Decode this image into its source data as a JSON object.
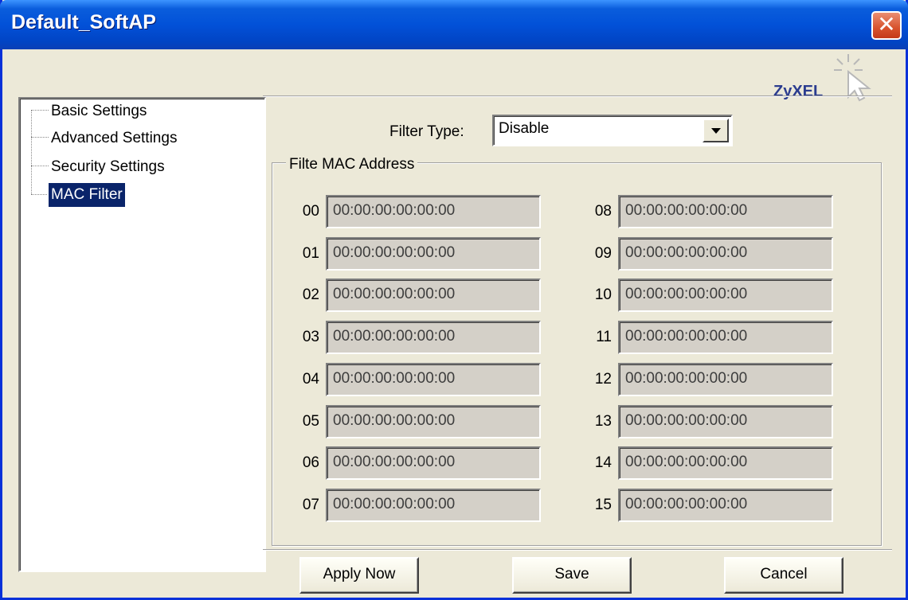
{
  "window": {
    "title": "Default_SoftAP",
    "close_glyph": "✕"
  },
  "logo": {
    "text": "ZyXEL",
    "icon": "cursor-click-icon"
  },
  "tree": {
    "items": [
      {
        "label": "Basic Settings",
        "selected": false
      },
      {
        "label": "Advanced Settings",
        "selected": false
      },
      {
        "label": "Security Settings",
        "selected": false
      },
      {
        "label": "MAC Filter",
        "selected": true
      }
    ]
  },
  "filter": {
    "label": "Filter Type:",
    "value": "Disable"
  },
  "mac_group": {
    "label": "Filte MAC Address",
    "entries": [
      {
        "index": "00",
        "mac": "00:00:00:00:00:00"
      },
      {
        "index": "01",
        "mac": "00:00:00:00:00:00"
      },
      {
        "index": "02",
        "mac": "00:00:00:00:00:00"
      },
      {
        "index": "03",
        "mac": "00:00:00:00:00:00"
      },
      {
        "index": "04",
        "mac": "00:00:00:00:00:00"
      },
      {
        "index": "05",
        "mac": "00:00:00:00:00:00"
      },
      {
        "index": "06",
        "mac": "00:00:00:00:00:00"
      },
      {
        "index": "07",
        "mac": "00:00:00:00:00:00"
      },
      {
        "index": "08",
        "mac": "00:00:00:00:00:00"
      },
      {
        "index": "09",
        "mac": "00:00:00:00:00:00"
      },
      {
        "index": "10",
        "mac": "00:00:00:00:00:00"
      },
      {
        "index": "11",
        "mac": "00:00:00:00:00:00"
      },
      {
        "index": "12",
        "mac": "00:00:00:00:00:00"
      },
      {
        "index": "13",
        "mac": "00:00:00:00:00:00"
      },
      {
        "index": "14",
        "mac": "00:00:00:00:00:00"
      },
      {
        "index": "15",
        "mac": "00:00:00:00:00:00"
      }
    ]
  },
  "buttons": {
    "apply": "Apply Now",
    "save": "Save",
    "cancel": "Cancel"
  },
  "colors": {
    "titlebar": "#0251d8",
    "selection": "#0a246a",
    "dialog_bg": "#ece9d8",
    "logo": "#2b3c8f"
  }
}
